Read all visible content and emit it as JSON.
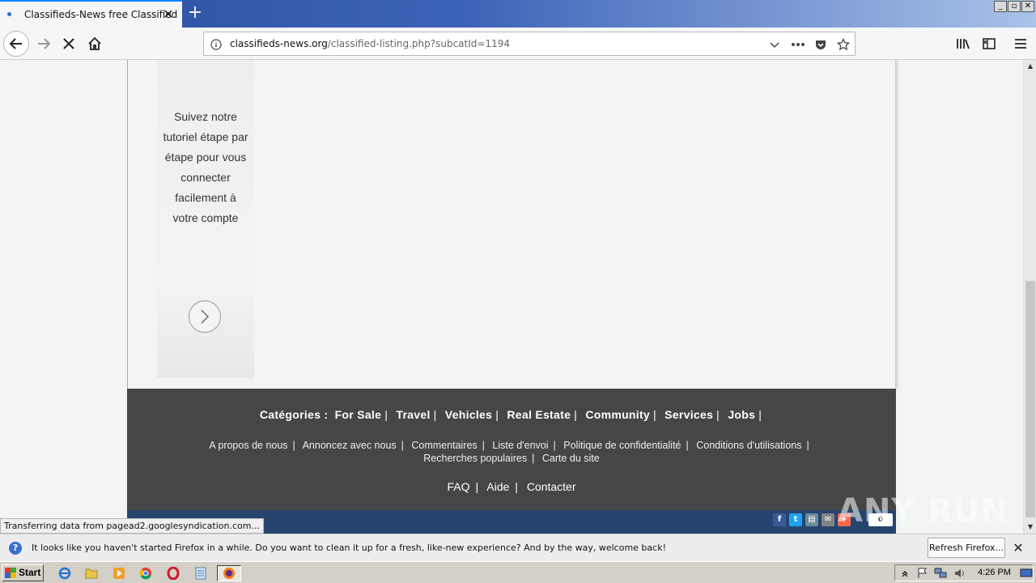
{
  "browser": {
    "tab_title": "Classifieds-News free Classified",
    "new_tab_label": "+",
    "url_host": "classifieds-news.org",
    "url_path": "/classified-listing.php?subcatId=1194",
    "window_buttons": [
      "_",
      "▫",
      "✕"
    ]
  },
  "sidebar": {
    "tutorial_text": "Suivez notre tutoriel étape par étape pour vous connecter facilement à votre compte"
  },
  "footer": {
    "categories_label": "Catégories :",
    "categories": [
      "For Sale",
      "Travel",
      "Vehicles",
      "Real Estate",
      "Community",
      "Services",
      "Jobs"
    ],
    "links_line1": [
      "A propos de nous",
      "Annoncez avec nous",
      "Commentaires",
      "Liste d'envoi",
      "Politique de confidentialité",
      "Conditions d'utilisations"
    ],
    "links_line2": [
      "Recherches populaires",
      "Carte du site"
    ],
    "bottom_links": [
      "FAQ",
      "Aide",
      "Contacter"
    ],
    "share_count": "0",
    "social_icons": [
      {
        "name": "facebook-icon",
        "glyph": "f",
        "color": "#3b5998"
      },
      {
        "name": "twitter-icon",
        "glyph": "t",
        "color": "#1da1f2"
      },
      {
        "name": "print-icon",
        "glyph": "▤",
        "color": "#6d8a99"
      },
      {
        "name": "email-icon",
        "glyph": "✉",
        "color": "#848484"
      },
      {
        "name": "addthis-icon",
        "glyph": "+",
        "color": "#f8694d"
      }
    ]
  },
  "watermark": "ANY RUN",
  "status_text": "Transferring data from pagead2.googlesyndication.com...",
  "notification": {
    "text": "It looks like you haven't started Firefox in a while. Do you want to clean it up for a fresh, like-new experience? And by the way, welcome back!",
    "button": "Refresh Firefox..."
  },
  "taskbar": {
    "start_label": "Start",
    "clock": "4:26 PM"
  }
}
